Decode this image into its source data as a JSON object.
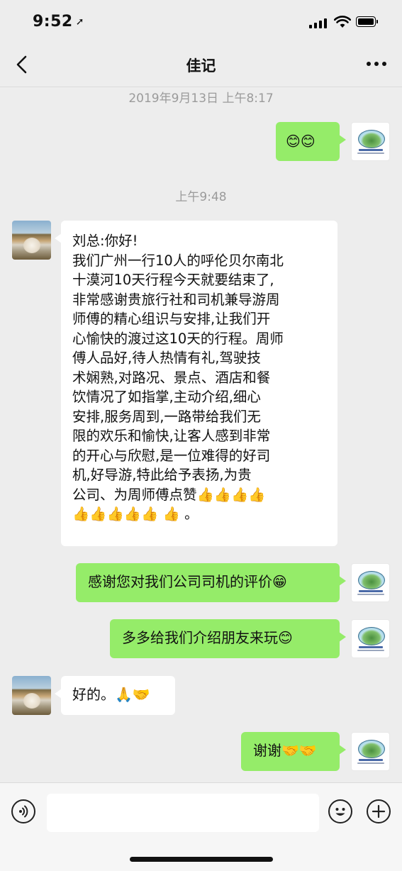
{
  "status": {
    "time": "9:52"
  },
  "header": {
    "title": "佳记"
  },
  "timestamps": [
    "2019年9月13日 上午8:17",
    "上午9:48"
  ],
  "messages": [
    {
      "from": "me",
      "text": "😊😊"
    },
    {
      "from": "other",
      "text": "刘总:你好!\n我们广州一行10人的呼伦贝尔南北\n十漠河10天行程今天就要结束了,\n非常感谢贵旅行社和司机兼导游周\n师傅的精心组识与安排,让我们开\n心愉快的渡过这10天的行程。周师\n傅人品好,待人热情有礼,驾驶技\n术娴熟,对路况、景点、酒店和餐\n饮情况了如指掌,主动介绍,细心\n安排,服务周到,一路带给我们无\n限的欢乐和愉快,让客人感到非常\n的开心与欣慰,是一位难得的好司\n机,好导游,特此给予表扬,为贵\n公司、为周师傅点赞👍👍👍👍\n👍👍👍👍👍 👍 。"
    },
    {
      "from": "me",
      "text": "感谢您对我们公司司机的评价😁"
    },
    {
      "from": "me",
      "text": "多多给我们介绍朋友来玩😊"
    },
    {
      "from": "other",
      "text": "好的。🙏🤝"
    },
    {
      "from": "me",
      "text": "谢谢🤝🤝"
    }
  ],
  "input": {
    "placeholder": ""
  },
  "icons": {
    "back": "chevron-left-icon",
    "more": "more-dots-icon",
    "voice": "voice-icon",
    "emoji": "emoji-icon",
    "add": "add-icon"
  },
  "colors": {
    "mine_bubble": "#95ec69",
    "other_bubble": "#ffffff",
    "background": "#ededed"
  }
}
